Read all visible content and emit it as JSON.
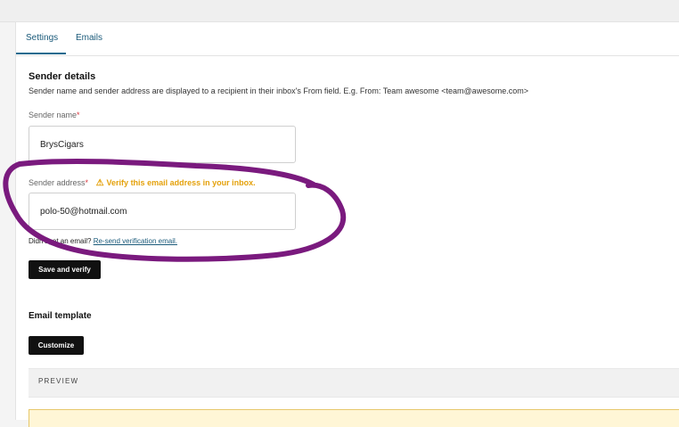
{
  "tabs": [
    {
      "label": "Settings",
      "active": true
    },
    {
      "label": "Emails",
      "active": false
    }
  ],
  "sender_details": {
    "title": "Sender details",
    "description": "Sender name and sender address are displayed to a recipient in their inbox's From field. E.g. From: Team awesome <team@awesome.com>"
  },
  "sender_name": {
    "label": "Sender name",
    "required_mark": "*",
    "value": "BrysCigars"
  },
  "sender_address": {
    "label": "Sender address",
    "required_mark": "*",
    "warning": "Verify this email address in your inbox.",
    "warning_icon": "warning-triangle-icon",
    "value": "polo-50@hotmail.com"
  },
  "resend": {
    "prompt": "Didn't get an email?",
    "link": "Re-send verification email."
  },
  "buttons": {
    "save_verify": "Save and verify",
    "customize": "Customize"
  },
  "email_template": {
    "title": "Email template",
    "preview_label": "PREVIEW"
  },
  "colors": {
    "annotation": "#7a1a7e",
    "warning": "#e4a10b",
    "link": "#1a5a7a",
    "button": "#111111"
  }
}
